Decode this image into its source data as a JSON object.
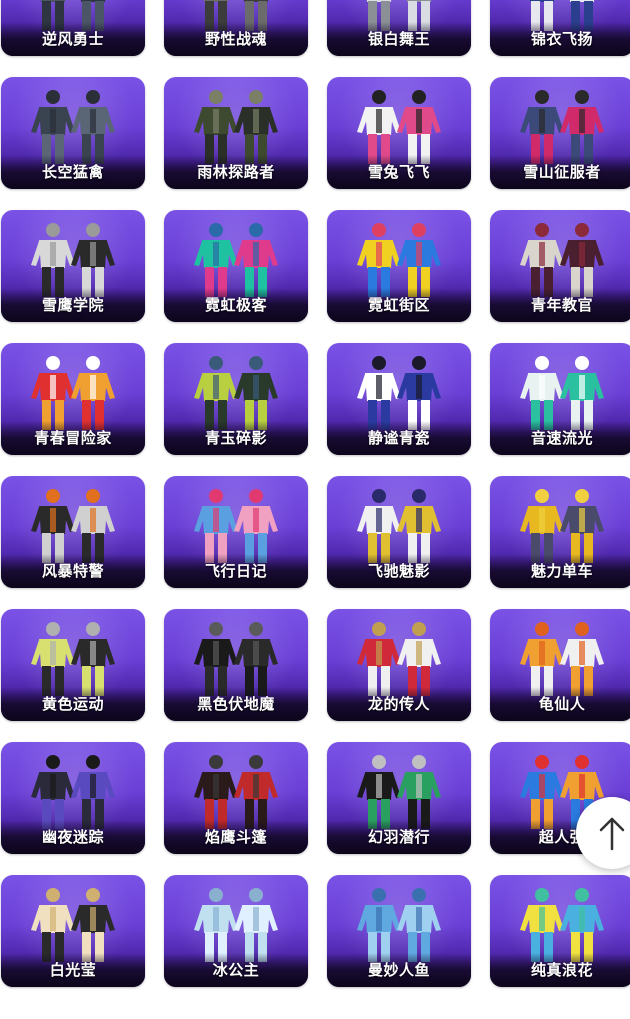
{
  "items": [
    {
      "name": "逆风勇士",
      "palette": [
        "#4a5565",
        "#2e3540",
        "#9aa3ad"
      ]
    },
    {
      "name": "野性战魂",
      "palette": [
        "#6b6b6b",
        "#3c3c3c",
        "#b08a55"
      ]
    },
    {
      "name": "银白舞王",
      "palette": [
        "#d9dde3",
        "#8b8f96",
        "#ffffff"
      ]
    },
    {
      "name": "锦衣飞扬",
      "palette": [
        "#2b3f8f",
        "#e7e7ef",
        "#1d2a5c"
      ]
    },
    {
      "name": "长空猛禽",
      "palette": [
        "#3a4350",
        "#5a6676",
        "#2a2f38"
      ]
    },
    {
      "name": "雨林探路者",
      "palette": [
        "#3d4a2f",
        "#2a2f28",
        "#7a7f66"
      ]
    },
    {
      "name": "雪兔飞飞",
      "palette": [
        "#f2f2f2",
        "#e04a8a",
        "#222222"
      ]
    },
    {
      "name": "雪山征服者",
      "palette": [
        "#3c4a7a",
        "#d02a6a",
        "#2a2a2a"
      ]
    },
    {
      "name": "雪鹰学院",
      "palette": [
        "#d8d8d8",
        "#2a2a2a",
        "#9a9a9a"
      ]
    },
    {
      "name": "霓虹极客",
      "palette": [
        "#1fc2a0",
        "#e03a8c",
        "#2a6aa8"
      ]
    },
    {
      "name": "霓虹街区",
      "palette": [
        "#f0d020",
        "#2a7ae0",
        "#e04060"
      ]
    },
    {
      "name": "青年教官",
      "palette": [
        "#d9d4cc",
        "#4a2030",
        "#8a2a3a"
      ]
    },
    {
      "name": "青春冒险家",
      "palette": [
        "#e03030",
        "#f0a030",
        "#ffffff"
      ]
    },
    {
      "name": "青玉碎影",
      "palette": [
        "#b8d040",
        "#2a3a2a",
        "#3a5a7a"
      ]
    },
    {
      "name": "静谧青瓷",
      "palette": [
        "#ffffff",
        "#2a3aa0",
        "#1a1a2a"
      ]
    },
    {
      "name": "音速流光",
      "palette": [
        "#e8f2f0",
        "#2ac0a0",
        "#ffffff"
      ]
    },
    {
      "name": "风暴特警",
      "palette": [
        "#2a2a2a",
        "#d0d0d0",
        "#e07020"
      ]
    },
    {
      "name": "飞行日记",
      "palette": [
        "#5aa0e0",
        "#f0a0c0",
        "#e03a70"
      ]
    },
    {
      "name": "飞驰魅影",
      "palette": [
        "#f0f0f0",
        "#e0c030",
        "#2a2a6a"
      ]
    },
    {
      "name": "魅力单车",
      "palette": [
        "#e8b820",
        "#4a4a6a",
        "#f0d040"
      ]
    },
    {
      "name": "黄色运动",
      "palette": [
        "#d8e070",
        "#2a2a2a",
        "#b0b0b0"
      ]
    },
    {
      "name": "黑色伏地魔",
      "palette": [
        "#1a1a1a",
        "#2a2a2a",
        "#5a5a5a"
      ]
    },
    {
      "name": "龙的传人",
      "palette": [
        "#d02a3a",
        "#f0f0f0",
        "#c0a050"
      ]
    },
    {
      "name": "龟仙人",
      "palette": [
        "#f0a030",
        "#f0f0f0",
        "#e06020"
      ]
    },
    {
      "name": "幽夜迷踪",
      "palette": [
        "#2a2a3a",
        "#5a4ac0",
        "#1a1a1a"
      ]
    },
    {
      "name": "焰鹰斗篷",
      "palette": [
        "#2a1a1a",
        "#c02a2a",
        "#3a3a3a"
      ]
    },
    {
      "name": "幻羽潜行",
      "palette": [
        "#1a1a1a",
        "#2aa060",
        "#c0c0c0"
      ]
    },
    {
      "name": "超人强",
      "palette": [
        "#2a7ae0",
        "#f0a030",
        "#e03030"
      ]
    },
    {
      "name": "白光莹",
      "palette": [
        "#f0e0c0",
        "#2a2a2a",
        "#d0b070"
      ]
    },
    {
      "name": "冰公主",
      "palette": [
        "#c0e0f0",
        "#e0f0ff",
        "#8ab0d0"
      ]
    },
    {
      "name": "曼妙人鱼",
      "palette": [
        "#60a8e0",
        "#a0d0f0",
        "#3a70b0"
      ]
    },
    {
      "name": "纯真浪花",
      "palette": [
        "#f0e040",
        "#4ab0e0",
        "#40c0a0"
      ]
    }
  ],
  "back_to_top": {
    "icon": "arrow-up-icon",
    "color": "#333333"
  }
}
